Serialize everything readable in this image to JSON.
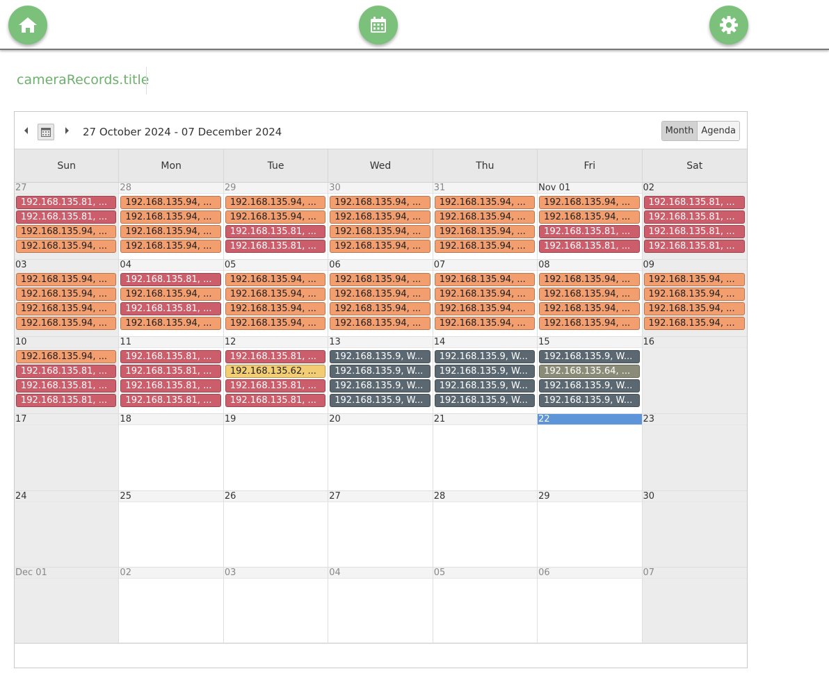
{
  "topbar": {
    "home_icon": "home-icon",
    "calendar_icon": "calendar-icon",
    "settings_icon": "gear-icon",
    "fab_color": "#7bc07b"
  },
  "page": {
    "title": "cameraRecords.title"
  },
  "scheduler": {
    "date_range": "27 October 2024 - 07 December 2024",
    "views": [
      {
        "label": "Month",
        "active": true
      },
      {
        "label": "Agenda",
        "active": false
      }
    ],
    "weekdays": [
      "Sun",
      "Mon",
      "Tue",
      "Wed",
      "Thu",
      "Fri",
      "Sat"
    ],
    "colors": {
      "orange": "#f29e6f",
      "red": "#cc5e6c",
      "yellow": "#f2cd74",
      "slate": "#5b6872",
      "olive": "#8a8c78",
      "today": "#5e95d8"
    },
    "weeks": [
      {
        "days": [
          {
            "label": "27",
            "muted": true,
            "events": [
              {
                "text": "192.168.135.81, ...",
                "color": "red"
              },
              {
                "text": "192.168.135.81, ...",
                "color": "red"
              },
              {
                "text": "192.168.135.94, ...",
                "color": "orange"
              },
              {
                "text": "192.168.135.94, ...",
                "color": "orange"
              }
            ]
          },
          {
            "label": "28",
            "muted": true,
            "events": [
              {
                "text": "192.168.135.94, ...",
                "color": "orange"
              },
              {
                "text": "192.168.135.94, ...",
                "color": "orange"
              },
              {
                "text": "192.168.135.94, ...",
                "color": "orange"
              },
              {
                "text": "192.168.135.94, ...",
                "color": "orange"
              }
            ]
          },
          {
            "label": "29",
            "muted": true,
            "events": [
              {
                "text": "192.168.135.94, ...",
                "color": "orange"
              },
              {
                "text": "192.168.135.94, ...",
                "color": "orange"
              },
              {
                "text": "192.168.135.81, ...",
                "color": "red"
              },
              {
                "text": "192.168.135.81, ...",
                "color": "red"
              }
            ]
          },
          {
            "label": "30",
            "muted": true,
            "events": [
              {
                "text": "192.168.135.94, ...",
                "color": "orange"
              },
              {
                "text": "192.168.135.94, ...",
                "color": "orange"
              },
              {
                "text": "192.168.135.94, ...",
                "color": "orange"
              },
              {
                "text": "192.168.135.94, ...",
                "color": "orange"
              }
            ]
          },
          {
            "label": "31",
            "muted": true,
            "events": [
              {
                "text": "192.168.135.94, ...",
                "color": "orange"
              },
              {
                "text": "192.168.135.94, ...",
                "color": "orange"
              },
              {
                "text": "192.168.135.94, ...",
                "color": "orange"
              },
              {
                "text": "192.168.135.94, ...",
                "color": "orange"
              }
            ]
          },
          {
            "label": "Nov 01",
            "events": [
              {
                "text": "192.168.135.94, ...",
                "color": "orange"
              },
              {
                "text": "192.168.135.94, ...",
                "color": "orange"
              },
              {
                "text": "192.168.135.81, ...",
                "color": "red"
              },
              {
                "text": "192.168.135.81, ...",
                "color": "red"
              }
            ]
          },
          {
            "label": "02",
            "events": [
              {
                "text": "192.168.135.81, ...",
                "color": "red"
              },
              {
                "text": "192.168.135.81, ...",
                "color": "red"
              },
              {
                "text": "192.168.135.81, ...",
                "color": "red"
              },
              {
                "text": "192.168.135.81, ...",
                "color": "red"
              }
            ]
          }
        ]
      },
      {
        "days": [
          {
            "label": "03",
            "events": [
              {
                "text": "192.168.135.94, ...",
                "color": "orange"
              },
              {
                "text": "192.168.135.94, ...",
                "color": "orange"
              },
              {
                "text": "192.168.135.94, ...",
                "color": "orange"
              },
              {
                "text": "192.168.135.94, ...",
                "color": "orange"
              }
            ]
          },
          {
            "label": "04",
            "events": [
              {
                "text": "192.168.135.81, ...",
                "color": "red"
              },
              {
                "text": "192.168.135.94, ...",
                "color": "orange"
              },
              {
                "text": "192.168.135.81, ...",
                "color": "red"
              },
              {
                "text": "192.168.135.94, ...",
                "color": "orange"
              }
            ]
          },
          {
            "label": "05",
            "events": [
              {
                "text": "192.168.135.94, ...",
                "color": "orange"
              },
              {
                "text": "192.168.135.94, ...",
                "color": "orange"
              },
              {
                "text": "192.168.135.94, ...",
                "color": "orange"
              },
              {
                "text": "192.168.135.94, ...",
                "color": "orange"
              }
            ]
          },
          {
            "label": "06",
            "events": [
              {
                "text": "192.168.135.94, ...",
                "color": "orange"
              },
              {
                "text": "192.168.135.94, ...",
                "color": "orange"
              },
              {
                "text": "192.168.135.94, ...",
                "color": "orange"
              },
              {
                "text": "192.168.135.94, ...",
                "color": "orange"
              }
            ]
          },
          {
            "label": "07",
            "events": [
              {
                "text": "192.168.135.94, ...",
                "color": "orange"
              },
              {
                "text": "192.168.135.94, ...",
                "color": "orange"
              },
              {
                "text": "192.168.135.94, ...",
                "color": "orange"
              },
              {
                "text": "192.168.135.94, ...",
                "color": "orange"
              }
            ]
          },
          {
            "label": "08",
            "events": [
              {
                "text": "192.168.135.94, ...",
                "color": "orange"
              },
              {
                "text": "192.168.135.94, ...",
                "color": "orange"
              },
              {
                "text": "192.168.135.94, ...",
                "color": "orange"
              },
              {
                "text": "192.168.135.94, ...",
                "color": "orange"
              }
            ]
          },
          {
            "label": "09",
            "events": [
              {
                "text": "192.168.135.94, ...",
                "color": "orange"
              },
              {
                "text": "192.168.135.94, ...",
                "color": "orange"
              },
              {
                "text": "192.168.135.94, ...",
                "color": "orange"
              },
              {
                "text": "192.168.135.94, ...",
                "color": "orange"
              }
            ]
          }
        ]
      },
      {
        "days": [
          {
            "label": "10",
            "events": [
              {
                "text": "192.168.135.94, ...",
                "color": "orange"
              },
              {
                "text": "192.168.135.81, ...",
                "color": "red"
              },
              {
                "text": "192.168.135.81, ...",
                "color": "red"
              },
              {
                "text": "192.168.135.81, ...",
                "color": "red"
              }
            ]
          },
          {
            "label": "11",
            "events": [
              {
                "text": "192.168.135.81, ...",
                "color": "red"
              },
              {
                "text": "192.168.135.81, ...",
                "color": "red"
              },
              {
                "text": "192.168.135.81, ...",
                "color": "red"
              },
              {
                "text": "192.168.135.81, ...",
                "color": "red"
              }
            ]
          },
          {
            "label": "12",
            "events": [
              {
                "text": "192.168.135.81, ...",
                "color": "red"
              },
              {
                "text": "192.168.135.62, ...",
                "color": "yellow"
              },
              {
                "text": "192.168.135.81, ...",
                "color": "red"
              },
              {
                "text": "192.168.135.81, ...",
                "color": "red"
              }
            ]
          },
          {
            "label": "13",
            "events": [
              {
                "text": "192.168.135.9, W...",
                "color": "slate"
              },
              {
                "text": "192.168.135.9, W...",
                "color": "slate"
              },
              {
                "text": "192.168.135.9, W...",
                "color": "slate"
              },
              {
                "text": "192.168.135.9, W...",
                "color": "slate"
              }
            ]
          },
          {
            "label": "14",
            "events": [
              {
                "text": "192.168.135.9, W...",
                "color": "slate"
              },
              {
                "text": "192.168.135.9, W...",
                "color": "slate"
              },
              {
                "text": "192.168.135.9, W...",
                "color": "slate"
              },
              {
                "text": "192.168.135.9, W...",
                "color": "slate"
              }
            ]
          },
          {
            "label": "15",
            "events": [
              {
                "text": "192.168.135.9, W...",
                "color": "slate"
              },
              {
                "text": "192.168.135.64, ...",
                "color": "olive"
              },
              {
                "text": "192.168.135.9, W...",
                "color": "slate"
              },
              {
                "text": "192.168.135.9, W...",
                "color": "slate"
              }
            ]
          },
          {
            "label": "16",
            "events": []
          }
        ]
      },
      {
        "days": [
          {
            "label": "17",
            "events": []
          },
          {
            "label": "18",
            "events": []
          },
          {
            "label": "19",
            "events": []
          },
          {
            "label": "20",
            "events": []
          },
          {
            "label": "21",
            "events": []
          },
          {
            "label": "22",
            "today": true,
            "events": []
          },
          {
            "label": "23",
            "events": []
          }
        ]
      },
      {
        "days": [
          {
            "label": "24",
            "events": []
          },
          {
            "label": "25",
            "events": []
          },
          {
            "label": "26",
            "events": []
          },
          {
            "label": "27",
            "events": []
          },
          {
            "label": "28",
            "events": []
          },
          {
            "label": "29",
            "events": []
          },
          {
            "label": "30",
            "events": []
          }
        ]
      },
      {
        "days": [
          {
            "label": "Dec 01",
            "muted": true,
            "events": []
          },
          {
            "label": "02",
            "muted": true,
            "events": []
          },
          {
            "label": "03",
            "muted": true,
            "events": []
          },
          {
            "label": "04",
            "muted": true,
            "events": []
          },
          {
            "label": "05",
            "muted": true,
            "events": []
          },
          {
            "label": "06",
            "muted": true,
            "events": []
          },
          {
            "label": "07",
            "muted": true,
            "events": []
          }
        ]
      }
    ]
  }
}
